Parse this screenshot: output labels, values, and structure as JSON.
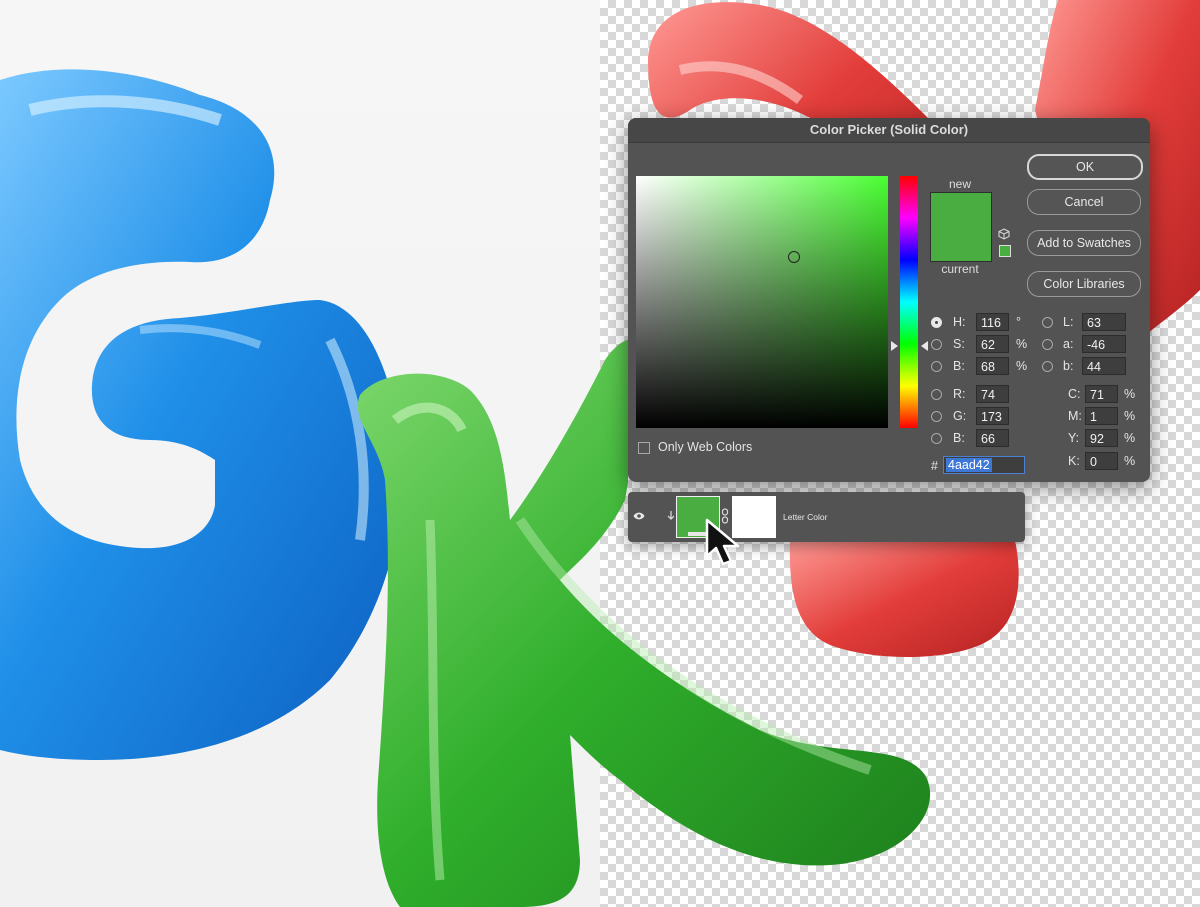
{
  "dialog": {
    "title": "Color Picker (Solid Color)",
    "new_label": "new",
    "current_label": "current",
    "buttons": {
      "ok": "OK",
      "cancel": "Cancel",
      "add_to_swatches": "Add to Swatches",
      "color_libraries": "Color Libraries"
    },
    "fields": {
      "H": {
        "label": "H:",
        "value": "116",
        "unit": "°"
      },
      "S": {
        "label": "S:",
        "value": "62",
        "unit": "%"
      },
      "B": {
        "label": "B:",
        "value": "68",
        "unit": "%"
      },
      "R": {
        "label": "R:",
        "value": "74"
      },
      "G": {
        "label": "G:",
        "value": "173"
      },
      "Bl": {
        "label": "B:",
        "value": "66"
      },
      "L": {
        "label": "L:",
        "value": "63"
      },
      "a": {
        "label": "a:",
        "value": "-46"
      },
      "b": {
        "label": "b:",
        "value": "44"
      },
      "C": {
        "label": "C:",
        "value": "71",
        "unit": "%"
      },
      "M": {
        "label": "M:",
        "value": "1",
        "unit": "%"
      },
      "Y": {
        "label": "Y:",
        "value": "92",
        "unit": "%"
      },
      "K": {
        "label": "K:",
        "value": "0",
        "unit": "%"
      }
    },
    "hex_prefix": "#",
    "hex_value": "4aad42",
    "web_colors_label": "Only Web Colors",
    "selected_color": "#4aad42"
  },
  "layer": {
    "name": "Letter Color",
    "fill_color": "#4aad42",
    "mask_color": "#ffffff"
  },
  "icons": [
    "eye-icon",
    "clip-icon",
    "link-icon",
    "cube-icon",
    "mouse-cursor-icon"
  ]
}
